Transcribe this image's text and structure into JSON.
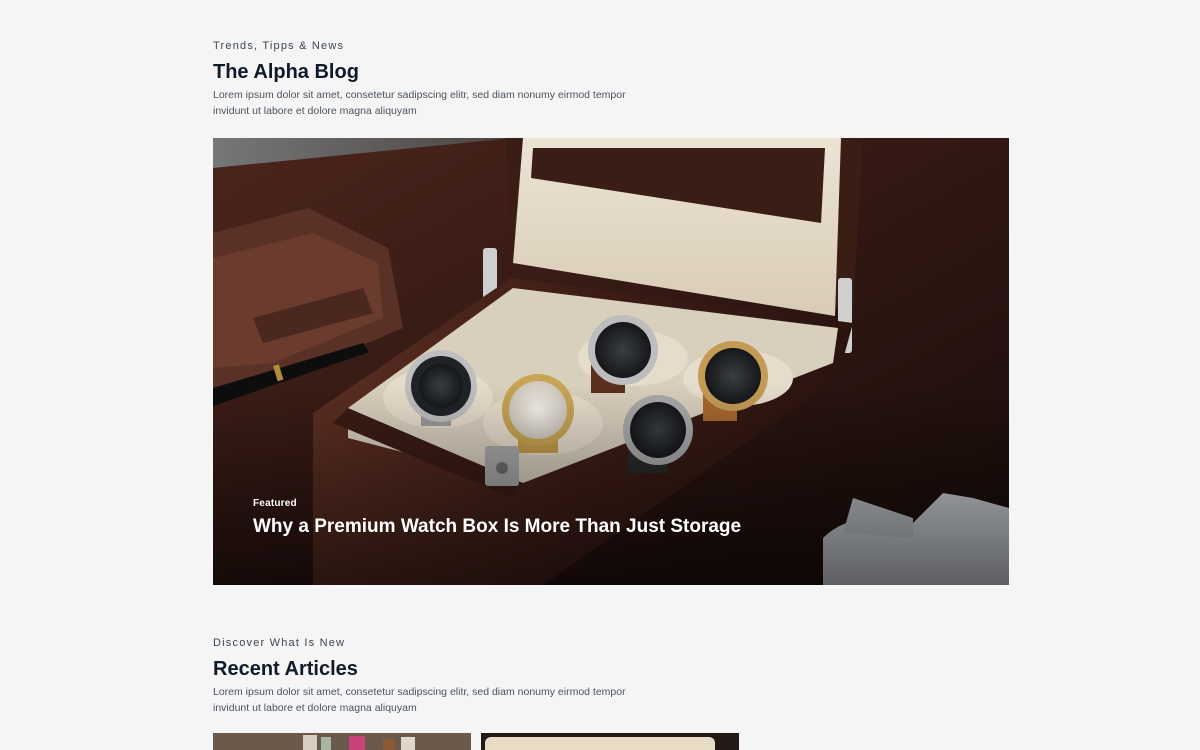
{
  "blog": {
    "eyebrow": "Trends, Tipps & News",
    "title": "The Alpha Blog",
    "description": "Lorem ipsum dolor sit amet, consetetur sadipscing elitr, sed diam nonumy eirmod tempor invidunt ut labore et dolore magna aliquyam"
  },
  "featured": {
    "tag": "Featured",
    "title": "Why a Premium Watch Box Is More Than Just Storage"
  },
  "recent": {
    "eyebrow": "Discover What Is New",
    "title": "Recent Articles",
    "description": "Lorem ipsum dolor sit amet, consetetur sadipscing elitr, sed diam nonumy eirmod tempor invidunt ut labore et dolore magna aliquyam"
  },
  "colors": {
    "text": "#0f1b2a",
    "background": "#f5f5f5",
    "overlay_text": "#ffffff"
  }
}
